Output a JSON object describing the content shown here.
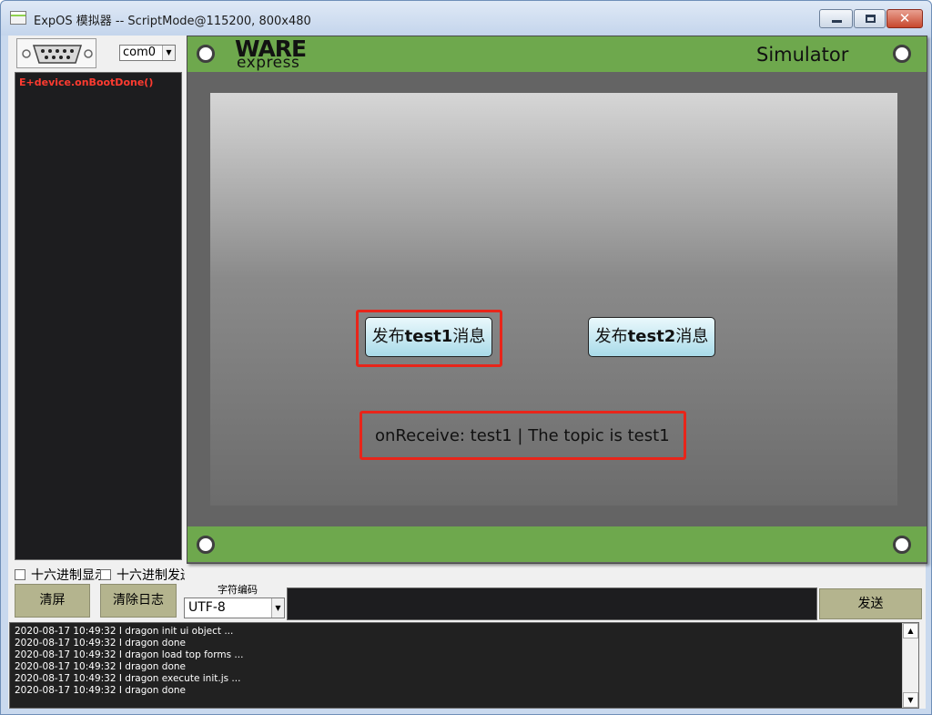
{
  "window": {
    "title": "ExpOS 模拟器 -- ScriptMode@115200, 800x480",
    "controls": {
      "minimize": "—",
      "maximize": "▢",
      "close": "✕"
    }
  },
  "left_panel": {
    "com_port": "com0",
    "console_lines": [
      "E+device.onBootDone()"
    ]
  },
  "simulator": {
    "logo_top": "WARE",
    "logo_bottom": "express",
    "title": "Simulator",
    "buttons": [
      {
        "prefix": "发布",
        "topic": "test1",
        "suffix": "消息"
      },
      {
        "prefix": "发布",
        "topic": "test2",
        "suffix": "消息"
      }
    ],
    "receive_text": "onReceive: test1 | The topic is test1",
    "highlight_color": "#e8251a",
    "bar_color": "#6ea84d"
  },
  "controls": {
    "hex_display_label": "十六进制显示",
    "hex_send_label": "十六进制发送",
    "clear_screen": "清屏",
    "clear_log": "清除日志",
    "encoding_label": "字符编码",
    "encoding_value": "UTF-8",
    "send": "发送"
  },
  "log": [
    "2020-08-17 10:49:32 I dragon init ui object ...",
    "2020-08-17 10:49:32 I dragon done",
    "2020-08-17 10:49:32 I dragon load top forms ...",
    "2020-08-17 10:49:32 I dragon done",
    "2020-08-17 10:49:32 I dragon execute init.js ...",
    "2020-08-17 10:49:32 I dragon done"
  ]
}
